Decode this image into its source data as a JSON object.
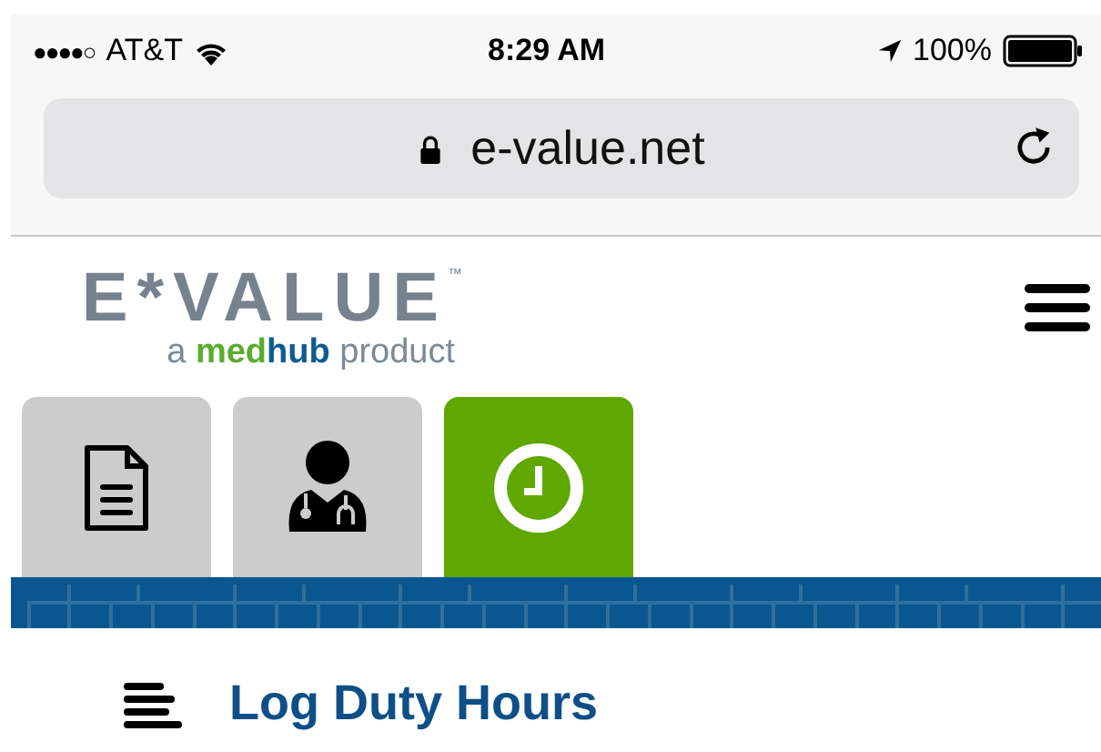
{
  "status_bar": {
    "signal_dots": "●●●●○",
    "carrier": "AT&T",
    "time": "8:29 AM",
    "battery": "100%"
  },
  "address_bar": {
    "url": "e-value.net"
  },
  "logo": {
    "brand": "E*VALUE",
    "trademark": "™",
    "tagline": [
      {
        "text": "a ",
        "kind": "plain"
      },
      {
        "text": "med",
        "kind": "green"
      },
      {
        "text": "hub",
        "kind": "blue"
      },
      {
        "text": " product",
        "kind": "plain"
      }
    ]
  },
  "tabs": [
    {
      "kind": "document",
      "selected": false
    },
    {
      "kind": "doctor",
      "selected": false
    },
    {
      "kind": "clock",
      "selected": true
    }
  ],
  "heading": {
    "title": "Log Duty Hours"
  }
}
